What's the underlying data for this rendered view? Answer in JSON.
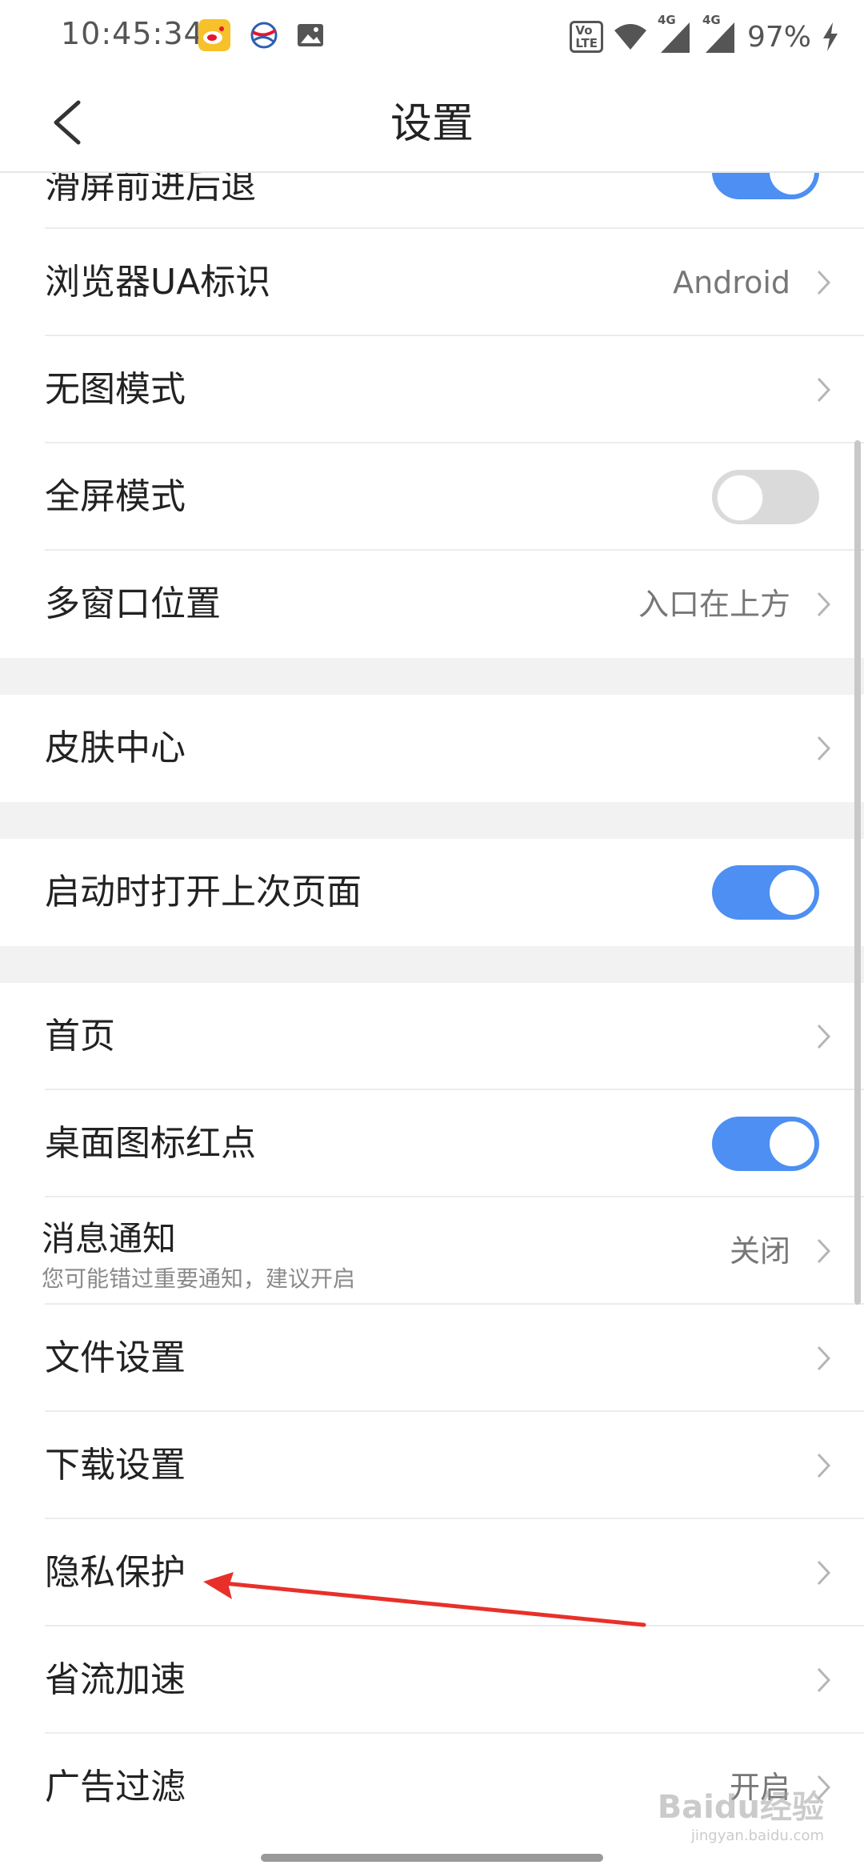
{
  "status_bar": {
    "time": "10:45:34",
    "network_1": "4G",
    "network_2": "4G",
    "battery": "97%",
    "volte": "VoLTE"
  },
  "header": {
    "title": "设置"
  },
  "rows": {
    "swipe_nav": {
      "label": "滑屏前进后退",
      "toggle": "on"
    },
    "ua": {
      "label": "浏览器UA标识",
      "value": "Android"
    },
    "no_image": {
      "label": "无图模式"
    },
    "fullscreen": {
      "label": "全屏模式",
      "toggle": "off"
    },
    "multiwindow": {
      "label": "多窗口位置",
      "value": "入口在上方"
    },
    "skin": {
      "label": "皮肤中心"
    },
    "restore": {
      "label": "启动时打开上次页面",
      "toggle": "on"
    },
    "homepage": {
      "label": "首页"
    },
    "badge": {
      "label": "桌面图标红点",
      "toggle": "on"
    },
    "notify": {
      "label": "消息通知",
      "sub": "您可能错过重要通知，建议开启",
      "value": "关闭"
    },
    "files": {
      "label": "文件设置"
    },
    "download": {
      "label": "下载设置"
    },
    "privacy": {
      "label": "隐私保护"
    },
    "datasaver": {
      "label": "省流加速"
    },
    "adblock": {
      "label": "广告过滤",
      "value": "开启"
    }
  },
  "watermark": {
    "text": "Baidu经验",
    "url": "jingyan.baidu.com"
  },
  "colors": {
    "accent": "#4d8ff2",
    "annotation": "#e8302a"
  }
}
